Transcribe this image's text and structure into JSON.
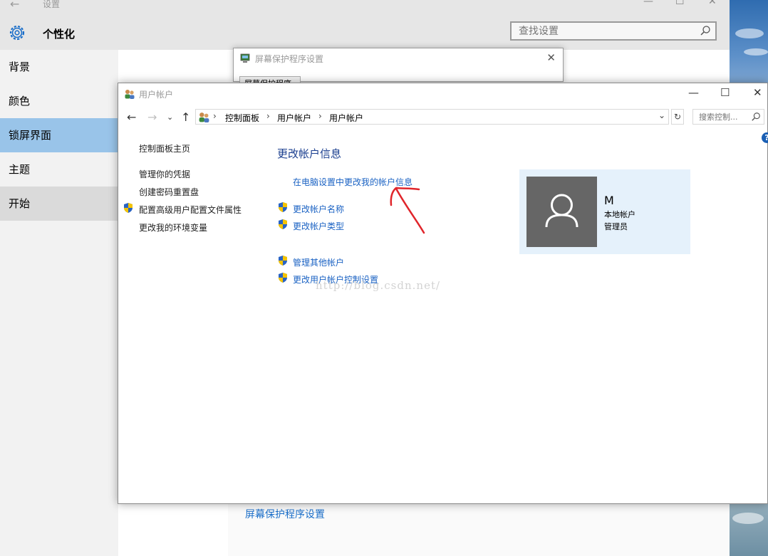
{
  "settings": {
    "window_title": "设置",
    "section_title": "个性化",
    "search_placeholder": "查找设置",
    "nav_items": [
      {
        "label": "背景"
      },
      {
        "label": "颜色"
      },
      {
        "label": "锁屏界面"
      },
      {
        "label": "主题"
      },
      {
        "label": "开始"
      }
    ],
    "screensaver_link": "屏幕保护程序设置"
  },
  "screensaver_dialog": {
    "title": "屏幕保护程序设置",
    "tab_label": "屏幕保护程序"
  },
  "user_accounts": {
    "title": "用户帐户",
    "breadcrumb": [
      "控制面板",
      "用户帐户",
      "用户帐户"
    ],
    "search_placeholder": "搜索控制...",
    "left_links": {
      "home": "控制面板主页",
      "credentials": "管理你的凭据",
      "reset_disk": "创建密码重置盘",
      "advanced_profile": "配置高级用户配置文件属性",
      "env_vars": "更改我的环境变量"
    },
    "heading": "更改帐户信息",
    "main_links": {
      "pc_settings": "在电脑设置中更改我的帐户信息",
      "change_name": "更改帐户名称",
      "change_type": "更改帐户类型",
      "manage_other": "管理其他帐户",
      "uac": "更改用户帐户控制设置"
    },
    "account": {
      "name": "M",
      "type": "本地帐户",
      "role": "管理员"
    }
  },
  "watermark": "http://blog.csdn.net/",
  "colors": {
    "nav_selected": "#99c4e9",
    "link_blue": "#1a62c3",
    "heading_blue": "#1a3e8f",
    "annotation_red": "#e0252b",
    "card_bg": "#e5f1fb"
  }
}
